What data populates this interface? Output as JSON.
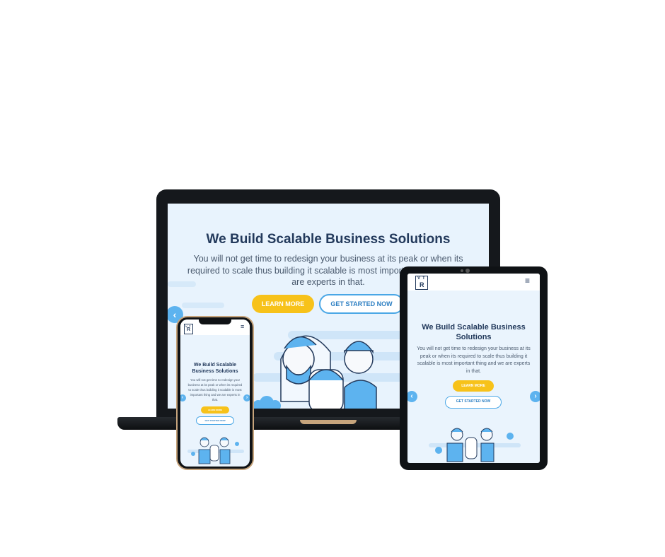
{
  "hero": {
    "title": "We Build Scalable Business Solutions",
    "description": "You will not get time to redesign your business at its peak or when its required to scale thus building it scalable is most important thing and we are experts in that.",
    "desc_line1": "You will not get time to redesign your business at its peak or when its",
    "desc_line2": "required to scale thus building it scalable is most important thing and we",
    "desc_line3": "are experts in that.",
    "learn_more": "LEARN MORE",
    "get_started": "GET STARTED NOW"
  },
  "tablet": {
    "title_line1": "We Build Scalable Business",
    "title_line2": "Solutions",
    "desc_line1": "You will not get time to redesign your business at its",
    "desc_line2": "peak or when its required to scale thus building it",
    "desc_line3": "scalable is most important thing and we are experts",
    "desc_line4": "in that."
  },
  "phone": {
    "title_line1": "We Build Scalable",
    "title_line2": "Business Solutions",
    "desc_line1": "You will not get time to redesign your",
    "desc_line2": "business at its peak or when its required",
    "desc_line3": "to scale thus building it scalable is most",
    "desc_line4": "important thing and we are experts in",
    "desc_line5": "that."
  },
  "logo": {
    "letters": [
      "V",
      "T",
      "R"
    ]
  },
  "icons": [
    "chevron-left-icon",
    "chevron-right-icon",
    "hamburger-menu-icon"
  ],
  "colors": {
    "accent_yellow": "#f7c21a",
    "accent_blue": "#4aa7e6",
    "heading": "#233a5c",
    "screen_bg": "#e8f3fd"
  }
}
